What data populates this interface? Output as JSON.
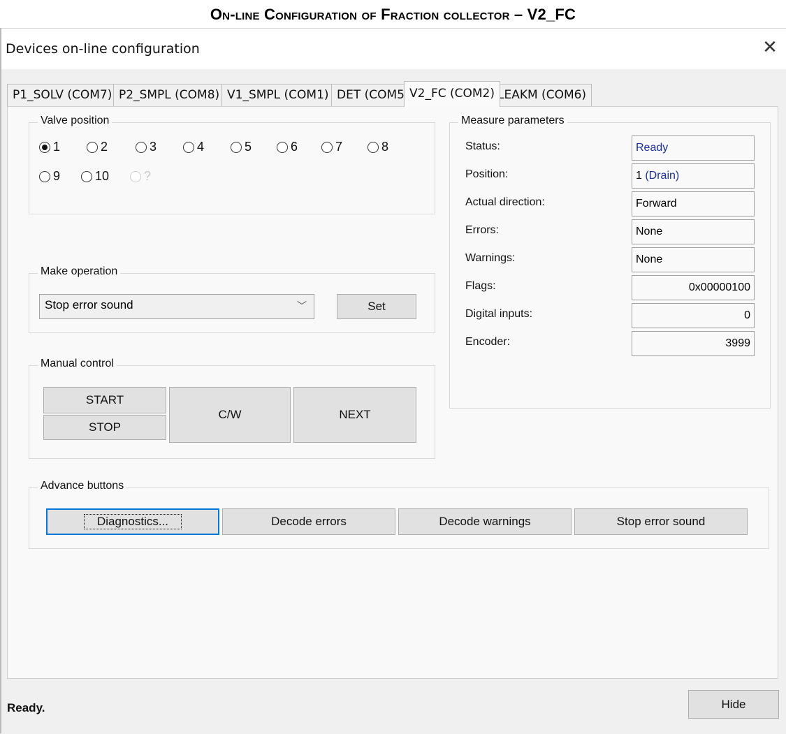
{
  "document": {
    "heading": "On-line Configuration of Fraction collector – V2_FC"
  },
  "window": {
    "title": "Devices on-line configuration",
    "close_glyph": "✕"
  },
  "tabs": [
    {
      "label": "P1_SOLV (COM7)",
      "active": false
    },
    {
      "label": "P2_SMPL (COM8)",
      "active": false
    },
    {
      "label": "V1_SMPL (COM1)",
      "active": false
    },
    {
      "label": "DET (COM5)",
      "active": false
    },
    {
      "label": "V2_FC (COM2)",
      "active": true
    },
    {
      "label": "LEAKM (COM6)",
      "active": false
    }
  ],
  "valve_position": {
    "title": "Valve position",
    "options": [
      "1",
      "2",
      "3",
      "4",
      "5",
      "6",
      "7",
      "8",
      "9",
      "10",
      "?"
    ],
    "selected": "1",
    "disabled": [
      "?"
    ]
  },
  "make_operation": {
    "title": "Make operation",
    "selected": "Stop error sound",
    "set_label": "Set"
  },
  "manual_control": {
    "title": "Manual control",
    "start_label": "START",
    "stop_label": "STOP",
    "cw_label": "C/W",
    "next_label": "NEXT"
  },
  "measure_parameters": {
    "title": "Measure parameters",
    "rows": [
      {
        "label": "Status:",
        "value": "Ready"
      },
      {
        "label": "Position:",
        "value_num": "1 ",
        "value_link": "(Drain)"
      },
      {
        "label": "Actual direction:",
        "value": "Forward"
      },
      {
        "label": "Errors:",
        "value": "None"
      },
      {
        "label": "Warnings:",
        "value": "None"
      },
      {
        "label": "Flags:",
        "value": "0x00000100"
      },
      {
        "label": "Digital inputs:",
        "value": "0"
      },
      {
        "label": "Encoder:",
        "value": "3999"
      }
    ]
  },
  "advance_buttons": {
    "title": "Advance buttons",
    "diagnostics": "Diagnostics...",
    "decode_errors": "Decode errors",
    "decode_warnings": "Decode warnings",
    "stop_error_sound": "Stop error sound"
  },
  "status_bar": {
    "text": "Ready.",
    "hide_label": "Hide"
  },
  "colors": {
    "window_bg": "#f0f0f0",
    "panel_bg": "#f9f9f9",
    "value_blue": "#1c2f92",
    "focus_blue": "#0078d7"
  }
}
